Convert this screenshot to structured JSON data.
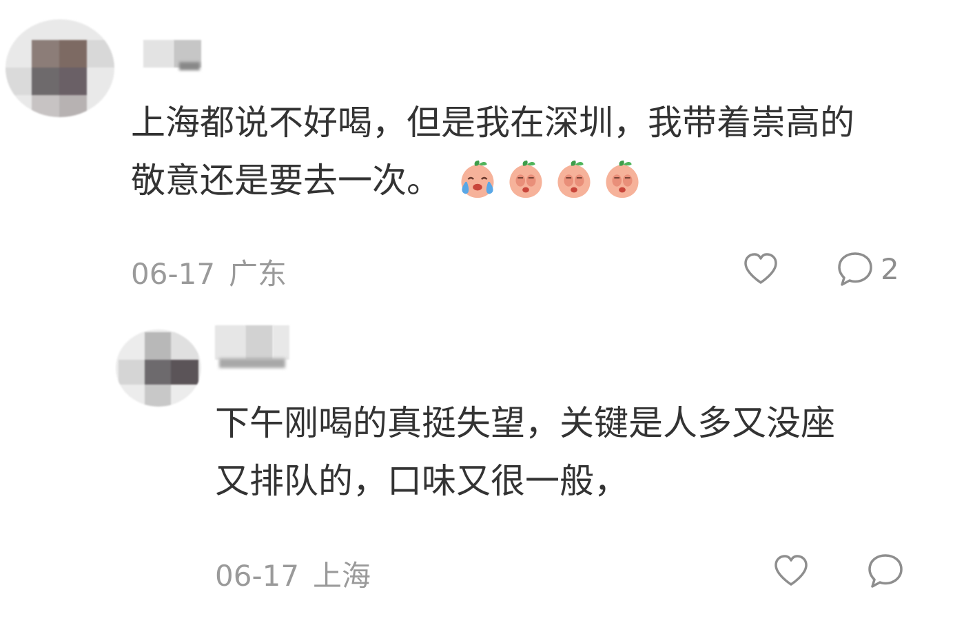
{
  "comments": [
    {
      "avatar": "blurred-avatar",
      "username": "",
      "text_line1": "上海都说不好喝，但是我在深圳，我带着崇高的",
      "text_line2": "敬意还是要去一次。",
      "emojis": [
        "crying-peach-emoji",
        "facepalm-peach-emoji",
        "facepalm-peach-emoji",
        "facepalm-peach-emoji"
      ],
      "date": "06-17",
      "region": "广东",
      "like_icon": "heart-outline-icon",
      "reply_icon": "speech-bubble-icon",
      "reply_count": "2"
    },
    {
      "avatar": "blurred-avatar",
      "username": "",
      "text_line1": "下午刚喝的真挺失望，关键是人多又没座",
      "text_line2": "又排队的，口味又很一般，",
      "date": "06-17",
      "region": "上海",
      "like_icon": "heart-outline-icon",
      "reply_icon": "speech-bubble-icon"
    }
  ],
  "colors": {
    "text": "#333333",
    "meta": "#9a9a9a",
    "icon": "#8e8e8e",
    "peach": "#f4a98f",
    "leaf": "#3e9d4a"
  }
}
